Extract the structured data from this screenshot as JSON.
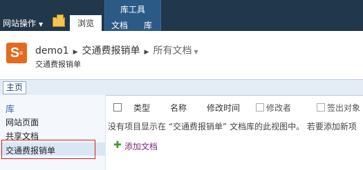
{
  "ribbon": {
    "site_actions": "网站操作",
    "tab_browse": "浏览",
    "context_group": "库工具",
    "tab_documents": "文档",
    "tab_library": "库"
  },
  "title": {
    "site_name": "demo1",
    "list_name": "交通费报销单",
    "view_name": "所有文档",
    "subtitle": "交通费报销单"
  },
  "top_nav": {
    "home": "主页"
  },
  "quick_launch": {
    "heading": "库",
    "items": [
      "网站页面",
      "共享文档",
      "交通费报销单"
    ]
  },
  "list": {
    "columns": [
      "类型",
      "名称",
      "修改时间",
      "修改者",
      "签出对象"
    ],
    "empty_message": "没有项目显示在 “交通费报销单” 文档库的此视图中。 若要添加新项",
    "add_document": "添加文档"
  },
  "colors": {
    "ribbon_bg": "#21374c",
    "context_tab": "#2c5a86",
    "highlight_border": "#e01a1a",
    "link_purple": "#7a2a7c"
  }
}
